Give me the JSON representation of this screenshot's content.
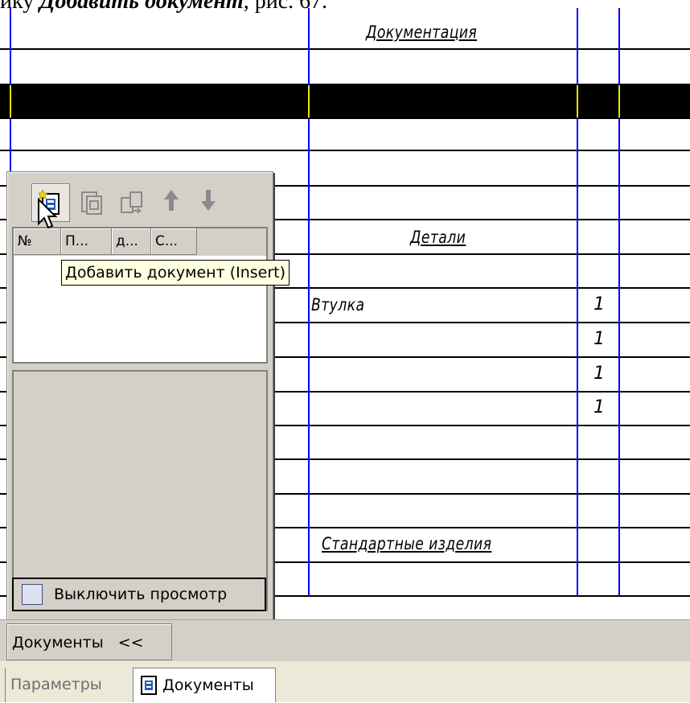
{
  "caption": {
    "before": "ику ",
    "italic": "Добавить документ",
    "after": ", рис. 67."
  },
  "table": {
    "section_documentation": "Документация",
    "section_details": "Детали",
    "row_part_name": "Втулка",
    "quantities": [
      "1",
      "1",
      "1",
      "1"
    ],
    "section_standard": "Стандартные изделия"
  },
  "panel": {
    "toolbar": {
      "add_icon": "add-document-icon",
      "copy_icon": "copy-document-icon",
      "replace_icon": "replace-document-icon",
      "up_icon": "arrow-up-icon",
      "down_icon": "arrow-down-icon"
    },
    "columns": [
      "№",
      "П...",
      "д...",
      "С..."
    ],
    "tooltip": "Добавить документ (Insert)",
    "preview_toggle": "Выключить просмотр"
  },
  "documents_button": {
    "label_first": "Д",
    "label_rest": "окументы",
    "suffix": "<<"
  },
  "tabs": {
    "params": "Параметры",
    "docs": "Документы"
  }
}
